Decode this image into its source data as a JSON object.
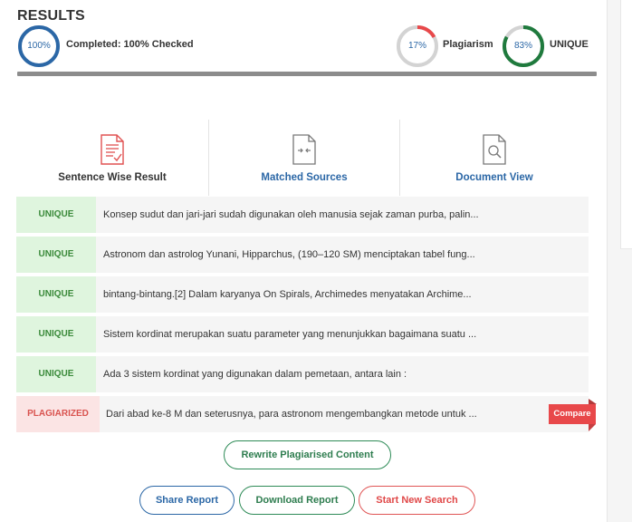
{
  "header": {
    "title": "RESULTS",
    "completed_percent": "100%",
    "completed_label": "Completed: 100% Checked",
    "plagiarism_percent": "17%",
    "plagiarism_label": "Plagiarism",
    "plagiarism_fraction": 0.17,
    "unique_percent": "83%",
    "unique_label": "UNIQUE",
    "unique_fraction": 0.83,
    "progress_fraction": 1.0
  },
  "colors": {
    "unique_bg": "#dff5de",
    "unique_text": "#3a8a3a",
    "plag_bg": "#fbe4e4",
    "plag_text": "#d9534f",
    "accent_blue": "#2b67a6",
    "accent_green": "#2e8b57",
    "accent_red": "#e8484a"
  },
  "tabs": [
    {
      "label": "Sentence Wise Result",
      "icon": "report-document-icon",
      "active": true
    },
    {
      "label": "Matched Sources",
      "icon": "compare-document-icon",
      "active": false
    },
    {
      "label": "Document View",
      "icon": "document-search-icon",
      "active": false
    }
  ],
  "results": [
    {
      "status": "UNIQUE",
      "text": "Konsep sudut dan jari-jari sudah digunakan oleh manusia sejak zaman purba, palin..."
    },
    {
      "status": "UNIQUE",
      "text": "Astronom dan astrolog Yunani, Hipparchus, (190–120 SM) menciptakan tabel fung..."
    },
    {
      "status": "UNIQUE",
      "text": "bintang-bintang.[2] Dalam karyanya On Spirals, Archimedes menyatakan Archime..."
    },
    {
      "status": "UNIQUE",
      "text": "Sistem kordinat merupakan suatu parameter yang menunjukkan bagaimana suatu ..."
    },
    {
      "status": "UNIQUE",
      "text": "Ada 3 sistem kordinat yang digunakan dalam pemetaan, antara lain :"
    },
    {
      "status": "PLAGIARIZED",
      "text": "Dari abad ke-8 M dan seterusnya, para astronom mengembangkan metode untuk ..."
    }
  ],
  "compare_label": "Compare",
  "actions": {
    "rewrite": "Rewrite Plagiarised Content",
    "share": "Share Report",
    "download": "Download Report",
    "new_search": "Start New Search"
  }
}
